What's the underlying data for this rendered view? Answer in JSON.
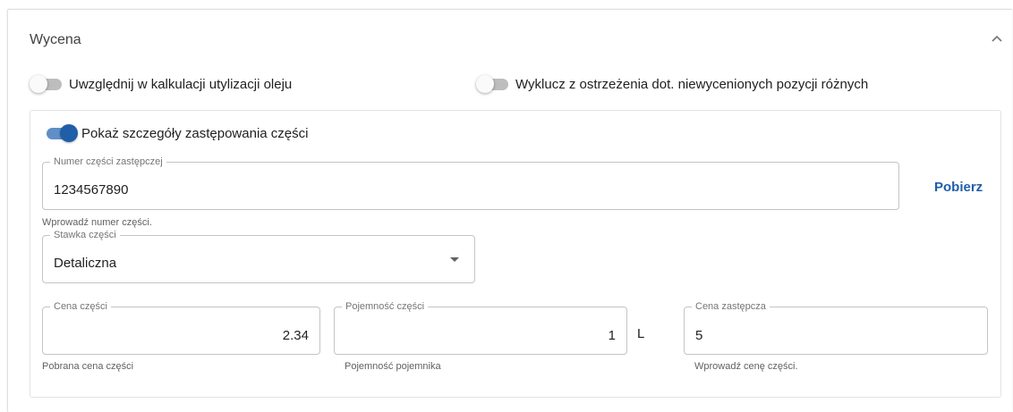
{
  "section": {
    "title": "Wycena",
    "toggles": [
      {
        "label": "Uwzględnij w kalkulacji utylizacji oleju",
        "on": false
      },
      {
        "label": "Wyklucz z ostrzeżenia dot. niewycenionych pozycji różnych",
        "on": false
      },
      {
        "label": "Pokaż szczegóły zastępowania części",
        "on": true
      }
    ]
  },
  "replacement_part": {
    "label": "Numer części zastępczej",
    "value": "1234567890",
    "helper": "Wprowadź numer części.",
    "fetch_label": "Pobierz"
  },
  "part_rate": {
    "label": "Stawka części",
    "value": "Detaliczna"
  },
  "part_price": {
    "label": "Cena części",
    "value": "2.34",
    "helper": "Pobrana cena części"
  },
  "part_capacity": {
    "label": "Pojemność części",
    "value": "1",
    "unit": "L",
    "helper": "Pojemność pojemnika"
  },
  "replacement_price": {
    "label": "Cena zastępcza",
    "value": "5",
    "helper": "Wprowadź cenę części."
  },
  "colors": {
    "accent": "#1f5ea8",
    "toggle_on_track": "#5f8fc6",
    "toggle_off_track": "#bdbdbd"
  },
  "icons": {
    "collapse": "chevron-up-icon",
    "select": "caret-down-icon"
  }
}
